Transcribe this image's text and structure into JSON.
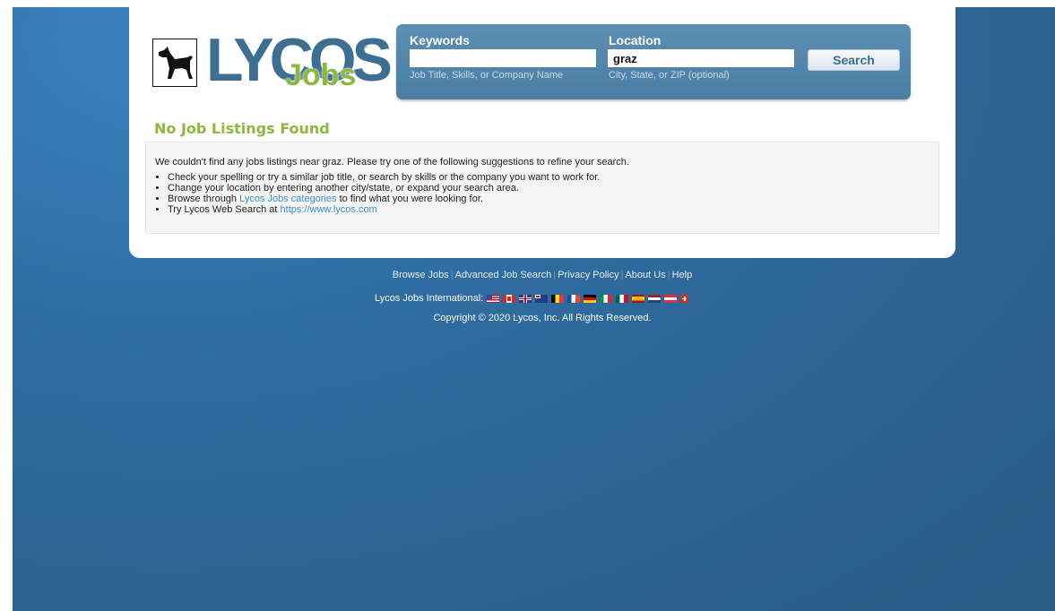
{
  "logo": {
    "brand": "LYCOS",
    "registered": "®",
    "product": "Jobs"
  },
  "search": {
    "keywords_label": "Keywords",
    "keywords_value": "",
    "keywords_hint": "Job Title, Skills, or Company Name",
    "location_label": "Location",
    "location_value": "graz",
    "location_hint": "City, State, or ZIP (optional)",
    "button_label": "Search"
  },
  "results": {
    "heading": "No Job Listings Found",
    "intro": "We couldn't find any jobs listings near graz. Please try one of the following suggestions to refine your search.",
    "suggestion_1": "Check your spelling or try a similar job title, or search by skills or the company you want to work for.",
    "suggestion_2": "Change your location by entering another city/state, or expand your search area.",
    "suggestion_3_before": "Browse through ",
    "suggestion_3_link": "Lycos Jobs categories",
    "suggestion_3_after": " to find what you were looking for.",
    "suggestion_4_before": "Try Lycos Web Search at ",
    "suggestion_4_link": "https://www.lycos.com"
  },
  "footer": {
    "links": [
      "Browse Jobs",
      "Advanced Job Search",
      "Privacy Policy",
      "About Us",
      "Help"
    ],
    "international_label": "Lycos Jobs International:",
    "flags": [
      "us-flag-icon",
      "ca-flag-icon",
      "uk-flag-icon",
      "au-flag-icon",
      "be-flag-icon",
      "fr-flag-icon",
      "de-flag-icon",
      "it-flag-icon",
      "mx-flag-icon",
      "es-flag-icon",
      "nl-flag-icon",
      "at-flag-icon",
      "ch-flag-icon"
    ],
    "copyright": "Copyright © 2020 Lycos, Inc. All Rights Reserved."
  },
  "colors": {
    "brand_blue": "#3d6f92",
    "brand_green": "#8db73f",
    "link_blue": "#3a8fd0",
    "background_blue": "#2f6ea4"
  }
}
